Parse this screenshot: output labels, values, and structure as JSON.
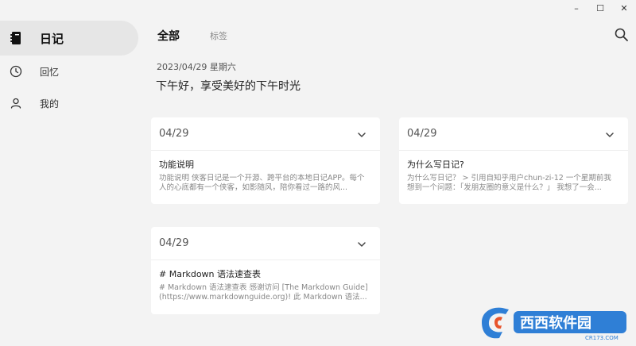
{
  "window": {
    "minimize": "–",
    "maximize": "☐",
    "close": "✕"
  },
  "sidebar": {
    "items": [
      {
        "label": "日记",
        "icon": "notebook-icon",
        "active": true
      },
      {
        "label": "回忆",
        "icon": "clock-icon",
        "active": false
      },
      {
        "label": "我的",
        "icon": "user-icon",
        "active": false
      }
    ]
  },
  "header": {
    "tabs": [
      {
        "label": "全部",
        "active": true
      },
      {
        "label": "标签",
        "active": false
      }
    ],
    "search_icon": "search-icon"
  },
  "main": {
    "date_line": "2023/04/29 星期六",
    "greeting": "下午好，享受美好的下午时光"
  },
  "cards": [
    {
      "date": "04/29",
      "title": "功能说明",
      "excerpt": "功能说明 侠客日记是一个开源、跨平台的本地日记APP。每个人的心底都有一个侠客，如影随风，陪你看过一路的风..."
    },
    {
      "date": "04/29",
      "title": "为什么写日记?",
      "excerpt": "为什么写日记？ > 引用自知乎用户chun-zi-12 一个星期前我想到一个问题：「发朋友圈的意义是什么？」 我想了一会..."
    },
    {
      "date": "04/29",
      "title": "# Markdown 语法速查表",
      "excerpt": "# Markdown 语法速查表 感谢访问 [The Markdown Guide](https://www.markdownguide.org)! 此 Markdown 语法..."
    }
  ],
  "watermark": {
    "text": "西西软件园",
    "sub": "CR173.COM"
  },
  "colors": {
    "background": "#f3f3f3",
    "card": "#ffffff",
    "active_nav": "#e6e6e6",
    "watermark_blue": "#2f7fd6",
    "watermark_red": "#e8542c"
  }
}
